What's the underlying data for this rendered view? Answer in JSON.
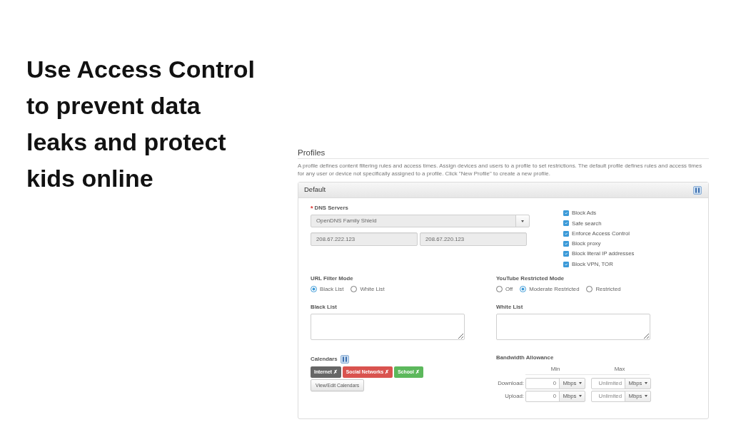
{
  "headline": "Use Access Control to prevent data leaks and protect kids online",
  "profiles": {
    "title": "Profiles",
    "description": "A profile defines content filtering rules and access times. Assign devices and users to a profile to set restrictions. The default profile defines rules and access times for any user or device not specifically assigned to a profile. Click \"New Profile\" to create a new profile.",
    "panel": {
      "title": "Default",
      "dns_servers": {
        "required_mark": "*",
        "label": "DNS Servers",
        "provider": "OpenDNS Family Shield",
        "addresses": [
          {
            "value": "208.67.222.123",
            "disabled": true
          },
          {
            "value": "208.67.220.123",
            "disabled": true
          }
        ]
      },
      "options": [
        {
          "label": "Block Ads",
          "checked": true
        },
        {
          "label": "Safe search",
          "checked": true
        },
        {
          "label": "Enforce Access Control",
          "checked": true
        },
        {
          "label": "Block proxy",
          "checked": true
        },
        {
          "label": "Block literal IP addresses",
          "checked": true
        },
        {
          "label": "Block VPN, TOR",
          "checked": true
        }
      ],
      "url_filter_mode": {
        "label": "URL Filter Mode",
        "options": [
          {
            "label": "Black List",
            "selected": true
          },
          {
            "label": "White List",
            "selected": false
          }
        ]
      },
      "youtube_restricted_mode": {
        "label": "YouTube Restricted Mode",
        "options": [
          {
            "label": "Off",
            "selected": false
          },
          {
            "label": "Moderate Restricted",
            "selected": true
          },
          {
            "label": "Restricted",
            "selected": false
          }
        ]
      },
      "black_list": {
        "label": "Black List"
      },
      "white_list": {
        "label": "White List"
      },
      "calendars": {
        "label": "Calendars",
        "tags": [
          {
            "label": "Internet ✗",
            "color": "#666666"
          },
          {
            "label": "Social Networks ✗",
            "color": "#d9534f"
          },
          {
            "label": "School ✗",
            "color": "#5cb85c"
          }
        ],
        "button": "View/Edit Calendars"
      },
      "bandwidth_allowance": {
        "label": "Bandwidth Allowance",
        "columns": [
          "Min",
          "Max"
        ],
        "rows": [
          {
            "label": "Download:",
            "min": {
              "value": "0",
              "unit": "Mbps"
            },
            "max": {
              "placeholder": "Unlimited",
              "unit": "Mbps"
            }
          },
          {
            "label": "Upload:",
            "min": {
              "value": "0",
              "unit": "Mbps"
            },
            "max": {
              "placeholder": "Unlimited",
              "unit": "Mbps"
            }
          }
        ]
      }
    }
  }
}
